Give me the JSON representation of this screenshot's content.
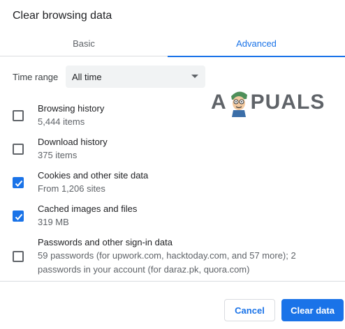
{
  "dialog": {
    "title": "Clear browsing data"
  },
  "tabs": [
    {
      "label": "Basic",
      "active": false
    },
    {
      "label": "Advanced",
      "active": true
    }
  ],
  "time_range": {
    "label": "Time range",
    "selected": "All time"
  },
  "watermark": {
    "text_left": "A",
    "text_right": "PUALS"
  },
  "options": [
    {
      "title": "Browsing history",
      "description": "5,444 items",
      "checked": false
    },
    {
      "title": "Download history",
      "description": "375 items",
      "checked": false
    },
    {
      "title": "Cookies and other site data",
      "description": "From 1,206 sites",
      "checked": true
    },
    {
      "title": "Cached images and files",
      "description": "319 MB",
      "checked": true
    },
    {
      "title": "Passwords and other sign-in data",
      "description": "59 passwords (for upwork.com, hacktoday.com, and 57 more); 2 passwords in your account (for daraz.pk, quora.com)",
      "checked": false
    }
  ],
  "footer": {
    "cancel_label": "Cancel",
    "clear_label": "Clear data"
  },
  "colors": {
    "accent": "#1a73e8",
    "text": "#202124",
    "secondary": "#5f6368",
    "divider": "#dadce0"
  }
}
